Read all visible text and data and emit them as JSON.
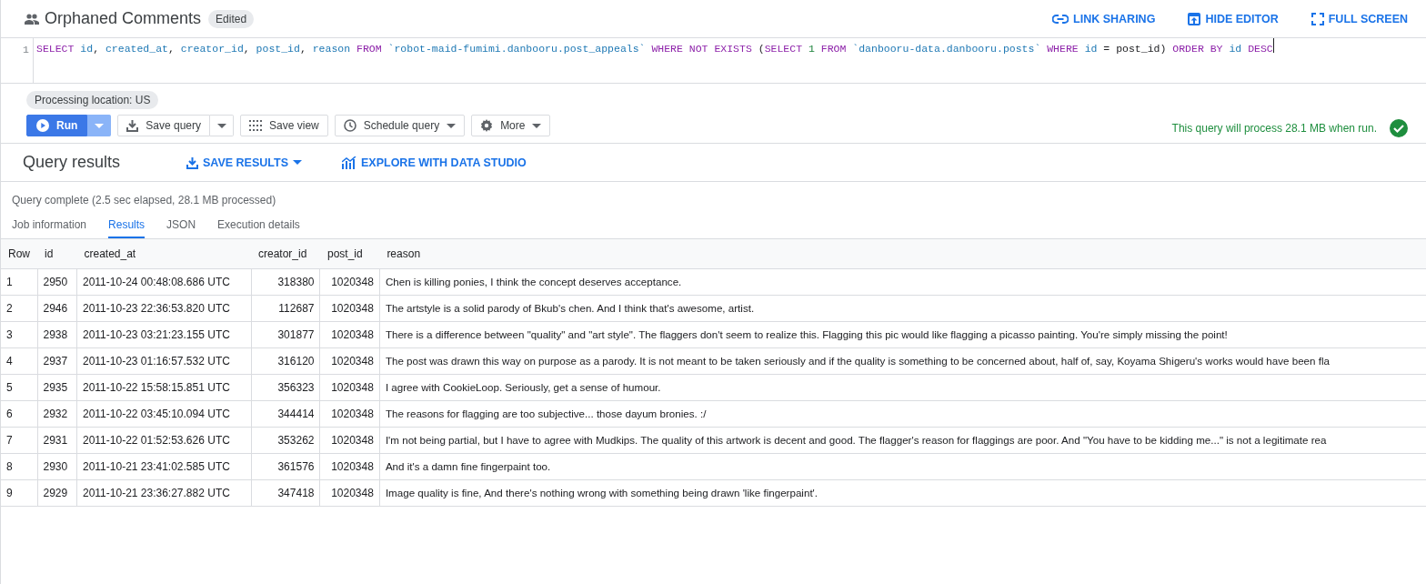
{
  "header": {
    "title": "Orphaned Comments",
    "badge": "Edited",
    "actions": [
      {
        "label": "LINK SHARING"
      },
      {
        "label": "HIDE EDITOR"
      },
      {
        "label": "FULL SCREEN"
      }
    ]
  },
  "editor": {
    "line_number": "1",
    "tokens": [
      {
        "text": "SELECT ",
        "kind": "keyword"
      },
      {
        "text": "id",
        "kind": "ident"
      },
      {
        "text": ", ",
        "kind": "plain"
      },
      {
        "text": "created_at",
        "kind": "ident"
      },
      {
        "text": ", ",
        "kind": "plain"
      },
      {
        "text": "creator_id",
        "kind": "ident"
      },
      {
        "text": ", ",
        "kind": "plain"
      },
      {
        "text": "post_id",
        "kind": "ident"
      },
      {
        "text": ", ",
        "kind": "plain"
      },
      {
        "text": "reason ",
        "kind": "ident"
      },
      {
        "text": "FROM ",
        "kind": "keyword"
      },
      {
        "text": "`robot-maid-fumimi.danbooru.post_appeals` ",
        "kind": "string"
      },
      {
        "text": "WHERE NOT EXISTS ",
        "kind": "keyword"
      },
      {
        "text": "(",
        "kind": "plain"
      },
      {
        "text": "SELECT ",
        "kind": "keyword"
      },
      {
        "text": "1 ",
        "kind": "number"
      },
      {
        "text": "FROM ",
        "kind": "keyword"
      },
      {
        "text": "`danbooru-data.danbooru.posts` ",
        "kind": "string"
      },
      {
        "text": "WHERE ",
        "kind": "keyword"
      },
      {
        "text": "id ",
        "kind": "ident"
      },
      {
        "text": "= post_id) ",
        "kind": "plain"
      },
      {
        "text": "ORDER BY ",
        "kind": "keyword"
      },
      {
        "text": "id ",
        "kind": "ident"
      },
      {
        "text": "DESC",
        "kind": "keyword"
      }
    ]
  },
  "processing_location": "Processing location: US",
  "toolbar": [
    {
      "label": "Run",
      "kind": "primary"
    },
    {
      "label": "Save query",
      "kind": "split"
    },
    {
      "label": "Save view",
      "kind": "plain"
    },
    {
      "label": "Schedule query",
      "kind": "menu"
    },
    {
      "label": "More",
      "kind": "menu"
    }
  ],
  "validator": "This query will process 28.1 MB when run.",
  "results": {
    "title": "Query results",
    "actions": [
      {
        "label": "SAVE RESULTS",
        "kind": "menu"
      },
      {
        "label": "EXPLORE WITH DATA STUDIO",
        "kind": "link"
      }
    ],
    "status": "Query complete (2.5 sec elapsed, 28.1 MB processed)",
    "tabs": [
      {
        "label": "Job information",
        "selected": false
      },
      {
        "label": "Results",
        "selected": true
      },
      {
        "label": "JSON",
        "selected": false
      },
      {
        "label": "Execution details",
        "selected": false
      }
    ]
  },
  "table": {
    "columns": [
      "Row",
      "id",
      "created_at",
      "creator_id",
      "post_id",
      "reason"
    ],
    "rows": [
      [
        "1",
        "2950",
        "2011-10-24 00:48:08.686 UTC",
        "318380",
        "1020348",
        "Chen is killing ponies, I think the concept deserves acceptance."
      ],
      [
        "2",
        "2946",
        "2011-10-23 22:36:53.820 UTC",
        "112687",
        "1020348",
        "The artstyle is a solid parody of Bkub's chen. And I think that's awesome, artist."
      ],
      [
        "3",
        "2938",
        "2011-10-23 03:21:23.155 UTC",
        "301877",
        "1020348",
        "There is a difference between \"quality\" and \"art style\". The flaggers don't seem to realize this. Flagging this pic would like flagging a picasso painting. You're simply missing the point!"
      ],
      [
        "4",
        "2937",
        "2011-10-23 01:16:57.532 UTC",
        "316120",
        "1020348",
        "The post was drawn this way on purpose as a parody. It is not meant to be taken seriously and if the quality is something to be concerned about, half of, say, Koyama Shigeru's works would have been fla"
      ],
      [
        "5",
        "2935",
        "2011-10-22 15:58:15.851 UTC",
        "356323",
        "1020348",
        "I agree with CookieLoop. Seriously, get a sense of humour."
      ],
      [
        "6",
        "2932",
        "2011-10-22 03:45:10.094 UTC",
        "344414",
        "1020348",
        "The reasons for flagging are too subjective... those dayum bronies. :/"
      ],
      [
        "7",
        "2931",
        "2011-10-22 01:52:53.626 UTC",
        "353262",
        "1020348",
        "I'm not being partial, but I have to agree with Mudkips. The quality of this artwork is decent and good. The flagger's reason for flaggings are poor. And \"You have to be kidding me...\" is not a legitimate rea"
      ],
      [
        "8",
        "2930",
        "2011-10-21 23:41:02.585 UTC",
        "361576",
        "1020348",
        "And it's a damn fine fingerpaint too."
      ],
      [
        "9",
        "2929",
        "2011-10-21 23:36:27.882 UTC",
        "347418",
        "1020348",
        "Image quality is fine, And there's nothing wrong with something being drawn 'like fingerpaint'."
      ]
    ]
  }
}
